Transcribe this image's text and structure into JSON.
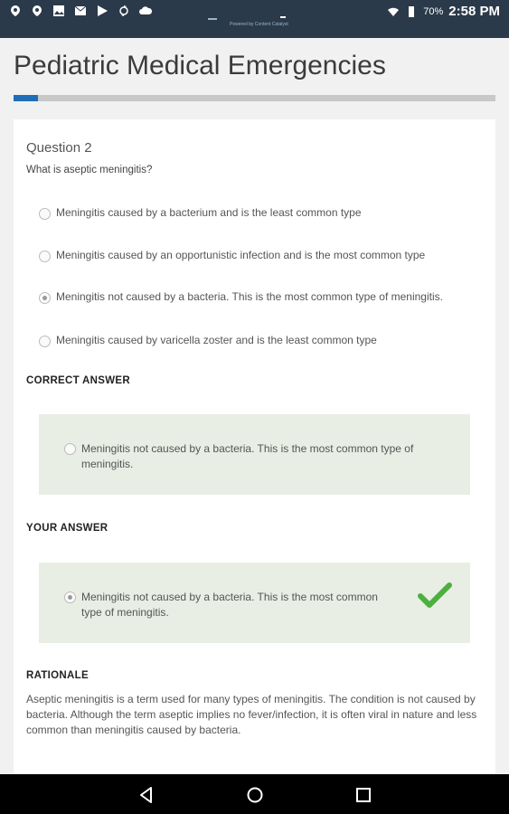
{
  "status_bar": {
    "left_icons": [
      "location-icon",
      "location-icon",
      "image-icon",
      "mail-icon",
      "play-store-icon",
      "sync-icon",
      "cloud-icon"
    ],
    "battery_percent": "70%",
    "time": "2:58 PM",
    "center_text": "Powered by Content Catalyst"
  },
  "header": {
    "title": "Pediatric Medical Emergencies",
    "progress": 0.05,
    "accent_color": "#1f6fb8"
  },
  "question": {
    "title": "Question 2",
    "text": "What is aseptic meningitis?",
    "options": [
      {
        "label": "Meningitis caused by a bacterium and is the least common type",
        "selected": false
      },
      {
        "label": "Meningitis caused by an opportunistic infection and is the most common type",
        "selected": false
      },
      {
        "label": "Meningitis not caused by a bacteria. This is the most common type of meningitis.",
        "selected": true
      },
      {
        "label": "Meningitis caused by varicella zoster and is the least common type",
        "selected": false
      }
    ]
  },
  "correct_answer": {
    "heading": "CORRECT ANSWER",
    "text": "Meningitis not caused by a bacteria. This is the most common type of meningitis."
  },
  "your_answer": {
    "heading": "YOUR ANSWER",
    "text": "Meningitis not caused by a bacteria. This is the most common type of meningitis.",
    "correct": true,
    "check_color": "#4caf3f"
  },
  "rationale": {
    "heading": "RATIONALE",
    "text": "Aseptic meningitis is a term used for many types of meningitis. The condition is not caused by bacteria. Although the term aseptic implies no fever/infection, it is often viral in nature and less common than meningitis caused by bacteria."
  },
  "nav_bar": {
    "icons": [
      "back-icon",
      "home-icon",
      "recents-icon"
    ]
  }
}
